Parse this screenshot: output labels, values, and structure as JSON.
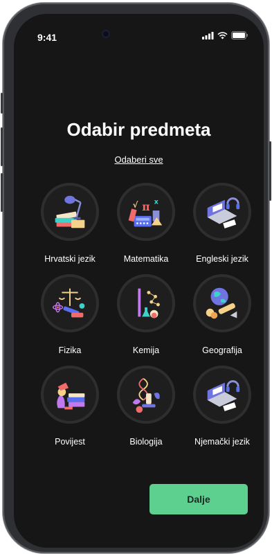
{
  "status_bar": {
    "time": "9:41"
  },
  "title": "Odabir predmeta",
  "select_all": "Odaberi sve",
  "subjects": [
    {
      "label": "Hrvatski jezik",
      "icon": "books-lamp-icon"
    },
    {
      "label": "Matematika",
      "icon": "math-formulas-icon"
    },
    {
      "label": "Engleski jezik",
      "icon": "laptop-headphones-icon"
    },
    {
      "label": "Fizika",
      "icon": "scale-atom-icon"
    },
    {
      "label": "Kemija",
      "icon": "molecule-flask-icon"
    },
    {
      "label": "Geografija",
      "icon": "globe-telescope-icon"
    },
    {
      "label": "Povijest",
      "icon": "history-books-icon"
    },
    {
      "label": "Biologija",
      "icon": "dna-microscope-icon"
    },
    {
      "label": "Njemački jezik",
      "icon": "laptop-headphones-icon"
    }
  ],
  "next_button": "Dalje",
  "colors": {
    "background": "#161616",
    "accent": "#5dd08f",
    "text": "#ffffff"
  }
}
